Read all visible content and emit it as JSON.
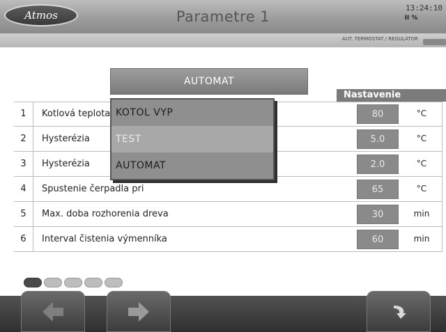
{
  "header": {
    "logo_text": "Atmos",
    "title": "Parametre 1",
    "time": "13:24:10",
    "status_icons": "II  %"
  },
  "subbar": {
    "text": "AUT. TERMOSTAT / REGULÁTOR"
  },
  "mode_button": {
    "label": "AUTOMAT"
  },
  "table": {
    "column_header": "Nastavenie",
    "rows": [
      {
        "num": "1",
        "label": "Kotlová teplota",
        "value": "80",
        "unit": "°C"
      },
      {
        "num": "2",
        "label": "Hysterézia",
        "value": "5.0",
        "unit": "°C"
      },
      {
        "num": "3",
        "label": "Hysterézia",
        "value": "2.0",
        "unit": "°C"
      },
      {
        "num": "4",
        "label": "Spustenie čerpadla pri",
        "value": "65",
        "unit": "°C"
      },
      {
        "num": "5",
        "label": "Max. doba rozhorenia dreva",
        "value": "30",
        "unit": "min"
      },
      {
        "num": "6",
        "label": "Interval čistenia výmenníka",
        "value": "60",
        "unit": "min"
      }
    ]
  },
  "dropdown": {
    "options": [
      "KOTOL VYP",
      "TEST",
      "AUTOMAT"
    ],
    "selected_index": 1
  },
  "pagination": {
    "pages": 5,
    "active_index": 0
  },
  "footer": {
    "left_button_icon": "arrow-left-icon",
    "right_button_icon": "arrow-right-icon",
    "back_button_icon": "return-icon"
  },
  "colors": {
    "header_bg": "#9a9a9a",
    "value_bg": "#8a8a8a",
    "footer_bg": "#3a3a3a",
    "dropdown_bg": "#8f8f8f"
  }
}
